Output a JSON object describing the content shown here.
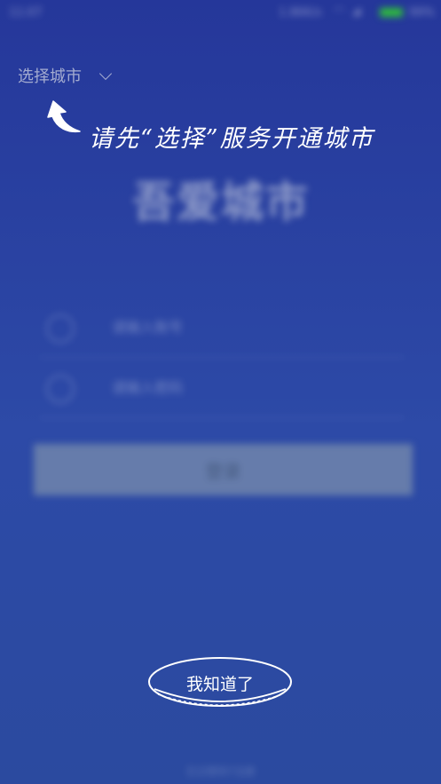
{
  "status_bar": {
    "time": "11:07",
    "speed": "1.86K/s",
    "battery_pct": "99%",
    "battery_color": "#2fbf3a"
  },
  "login": {
    "app_name": "吾爱城市",
    "account_placeholder": "请输入账号",
    "password_placeholder": "请输入密码",
    "login_label": "登录",
    "bottom_text": "忘记密码?注册"
  },
  "guide": {
    "city_selector_label": "选择城市",
    "tip": "请先“选择”服务开通城市",
    "confirm_label": "我知道了"
  },
  "icons": {
    "account": "user-icon",
    "password": "lock-icon",
    "arrow": "curved-arrow-up-icon",
    "dropdown": "chevron-down-icon"
  }
}
